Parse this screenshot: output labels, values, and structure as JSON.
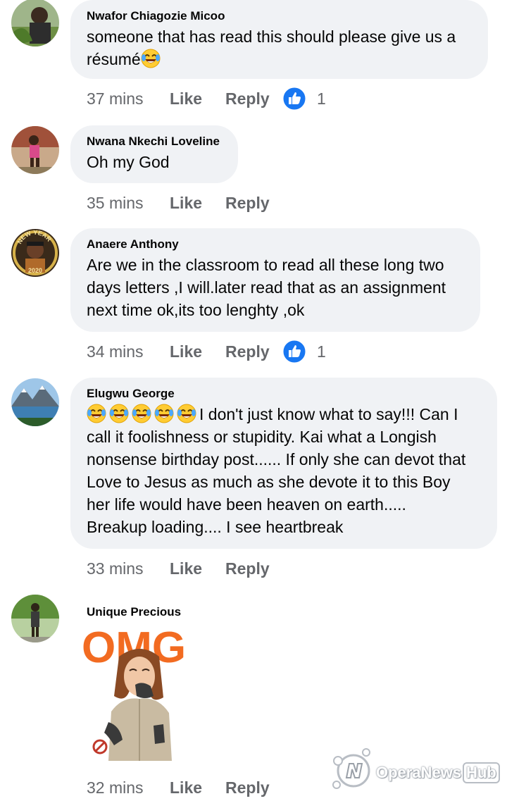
{
  "comments": [
    {
      "author": "Nwafor Chiagozie Micoo",
      "text_line1": "someone that has read this should please give us a",
      "text_line2": "résumé",
      "text_emoji": "laughing-tears-icon",
      "time": "37 mins",
      "like_label": "Like",
      "reply_label": "Reply",
      "reaction_icon": "thumbs-up-icon",
      "reaction_count": "1"
    },
    {
      "author": "Nwana Nkechi Loveline",
      "text": "Oh my God",
      "time": "35 mins",
      "like_label": "Like",
      "reply_label": "Reply"
    },
    {
      "author": "Anaere Anthony",
      "text_lines": [
        "Are we in the classroom to read all these long two",
        "days letters ,I will.later read that as an assignment",
        "next time ok,its too lenghty ,ok"
      ],
      "time": "34 mins",
      "like_label": "Like",
      "reply_label": "Reply",
      "reaction_icon": "thumbs-up-icon",
      "reaction_count": "1",
      "avatar_text_top": "NEW YEAR",
      "avatar_text_bottom": "2020"
    },
    {
      "author": "Elugwu George",
      "emoji_count": 5,
      "text_lines": [
        "I don't just know what to say!!! Can I",
        "call it foolishness or stupidity. Kai what a Longish",
        "nonsense birthday post...... If only she can devot that",
        "Love to Jesus as much as she devote it to this Boy",
        "her life would have  been heaven on earth.....",
        "Breakup loading.... I see heartbreak"
      ],
      "time": "33 mins",
      "like_label": "Like",
      "reply_label": "Reply"
    },
    {
      "author": "Unique Precious",
      "sticker_text": "OMG",
      "time": "32 mins",
      "like_label": "Like",
      "reply_label": "Reply"
    }
  ],
  "watermark": {
    "text": "OperaNews",
    "hub": "Hub"
  },
  "colors": {
    "bubble": "#f0f2f5",
    "meta": "#65676b",
    "like_blue": "#1877f2",
    "sticker_orange": "#f26b21"
  }
}
